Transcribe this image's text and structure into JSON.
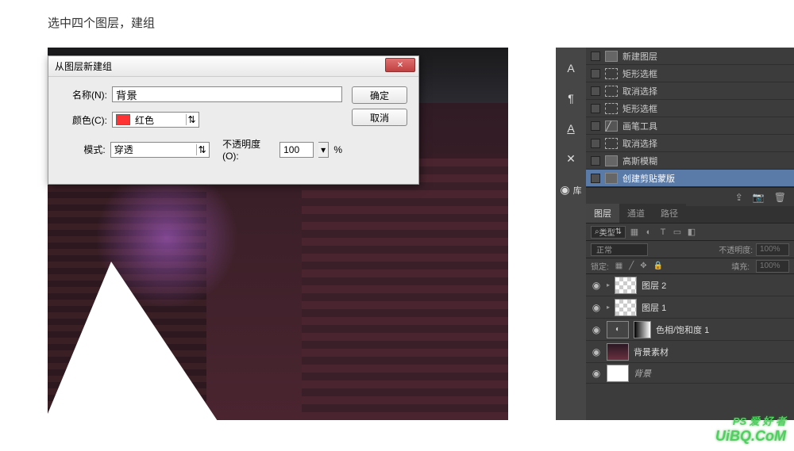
{
  "caption": "选中四个图层，建组",
  "dialog": {
    "title": "从图层新建组",
    "name_label": "名称(N):",
    "name_value": "背景",
    "color_label": "颜色(C):",
    "color_value": "红色",
    "mode_label": "模式:",
    "mode_value": "穿透",
    "opacity_label": "不透明度(O):",
    "opacity_value": "100",
    "opacity_suffix": "%",
    "ok": "确定",
    "cancel": "取消"
  },
  "mini_tools": {
    "char": "A",
    "para": "¶",
    "glyph": "A",
    "tools": "✕",
    "lib": "◉",
    "lib_label": "库"
  },
  "history": {
    "items": [
      {
        "label": "新建图层",
        "icon": "doc"
      },
      {
        "label": "矩形选框",
        "icon": "marquee"
      },
      {
        "label": "取消选择",
        "icon": "marquee"
      },
      {
        "label": "矩形选框",
        "icon": "marquee"
      },
      {
        "label": "画笔工具",
        "icon": "brush"
      },
      {
        "label": "取消选择",
        "icon": "marquee"
      },
      {
        "label": "高斯模糊",
        "icon": "doc"
      },
      {
        "label": "创建剪贴蒙版",
        "icon": "doc",
        "selected": true
      }
    ]
  },
  "layers_panel": {
    "tabs": {
      "layers": "图层",
      "channels": "通道",
      "paths": "路径"
    },
    "filter_label": "类型",
    "filter_kind": "⌕",
    "blend": "正常",
    "opacity_label": "不透明度:",
    "opacity_value": "100%",
    "lock_label": "锁定:",
    "fill_label": "填充:",
    "fill_value": "100%",
    "layers": [
      {
        "name": "图层 2",
        "thumb": "checker",
        "arrow": true
      },
      {
        "name": "图层 1",
        "thumb": "checker",
        "arrow": true
      },
      {
        "name": "色相/饱和度 1",
        "thumb": "adjust",
        "mask": true
      },
      {
        "name": "背景素材",
        "thumb": "img"
      },
      {
        "name": "背景",
        "thumb": "white",
        "bg": true
      }
    ]
  },
  "watermark": {
    "top": "PS 爱 好 者",
    "bottom": "UiBQ.CoM"
  }
}
